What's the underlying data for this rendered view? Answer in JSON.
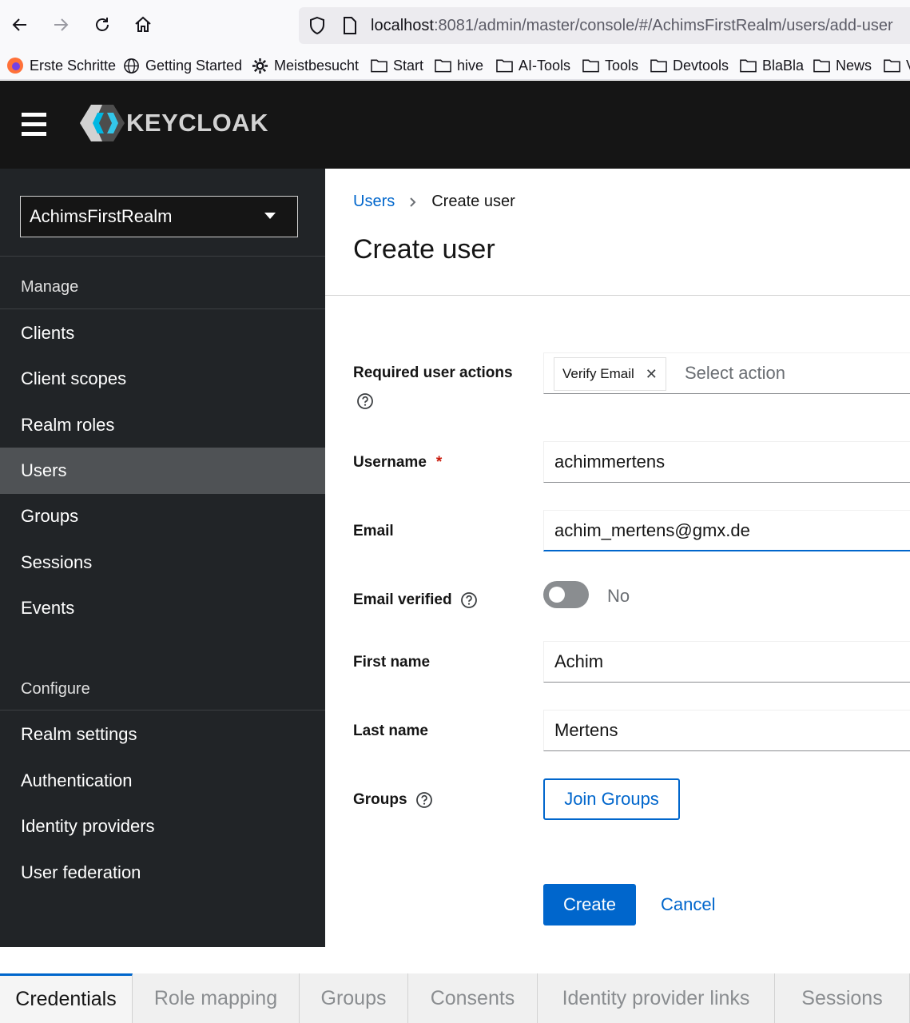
{
  "browser": {
    "url_host": "localhost",
    "url_path": ":8081/admin/master/console/#/AchimsFirstRealm/users/add-user",
    "bookmarks": [
      {
        "label": "Erste Schritte",
        "icon": "firefox-icon"
      },
      {
        "label": "Getting Started",
        "icon": "globe-icon"
      },
      {
        "label": "Meistbesucht",
        "icon": "gear-icon"
      },
      {
        "label": "Start",
        "icon": "folder-icon"
      },
      {
        "label": "hive",
        "icon": "folder-icon"
      },
      {
        "label": "AI-Tools",
        "icon": "folder-icon"
      },
      {
        "label": "Tools",
        "icon": "folder-icon"
      },
      {
        "label": "Devtools",
        "icon": "folder-icon"
      },
      {
        "label": "BlaBla",
        "icon": "folder-icon"
      },
      {
        "label": "News",
        "icon": "folder-icon"
      },
      {
        "label": "V",
        "icon": "folder-icon"
      }
    ]
  },
  "header": {
    "logo_text": "KEYCLOAK"
  },
  "sidebar": {
    "realm": "AchimsFirstRealm",
    "manage_label": "Manage",
    "manage_items": [
      "Clients",
      "Client scopes",
      "Realm roles",
      "Users",
      "Groups",
      "Sessions",
      "Events"
    ],
    "active_item": "Users",
    "configure_label": "Configure",
    "configure_items": [
      "Realm settings",
      "Authentication",
      "Identity providers",
      "User federation"
    ]
  },
  "main": {
    "breadcrumb_parent": "Users",
    "breadcrumb_current": "Create user",
    "title": "Create user",
    "form": {
      "required_actions_label": "Required user actions",
      "required_action_chip": "Verify Email",
      "required_actions_placeholder": "Select action",
      "username_label": "Username",
      "username_required": "*",
      "username_value": "achimmertens",
      "email_label": "Email",
      "email_value": "achim_mertens@gmx.de",
      "email_verified_label": "Email verified",
      "email_verified_value": "No",
      "first_name_label": "First name",
      "first_name_value": "Achim",
      "last_name_label": "Last name",
      "last_name_value": "Mertens",
      "groups_label": "Groups",
      "join_groups_button": "Join Groups",
      "create_button": "Create",
      "cancel_button": "Cancel"
    }
  },
  "tabs": [
    "Credentials",
    "Role mapping",
    "Groups",
    "Consents",
    "Identity provider links",
    "Sessions"
  ],
  "active_tab": "Credentials",
  "colors": {
    "primary": "#0066cc",
    "sidebar_bg": "#212427",
    "header_bg": "#151515",
    "required": "#c9190b"
  }
}
